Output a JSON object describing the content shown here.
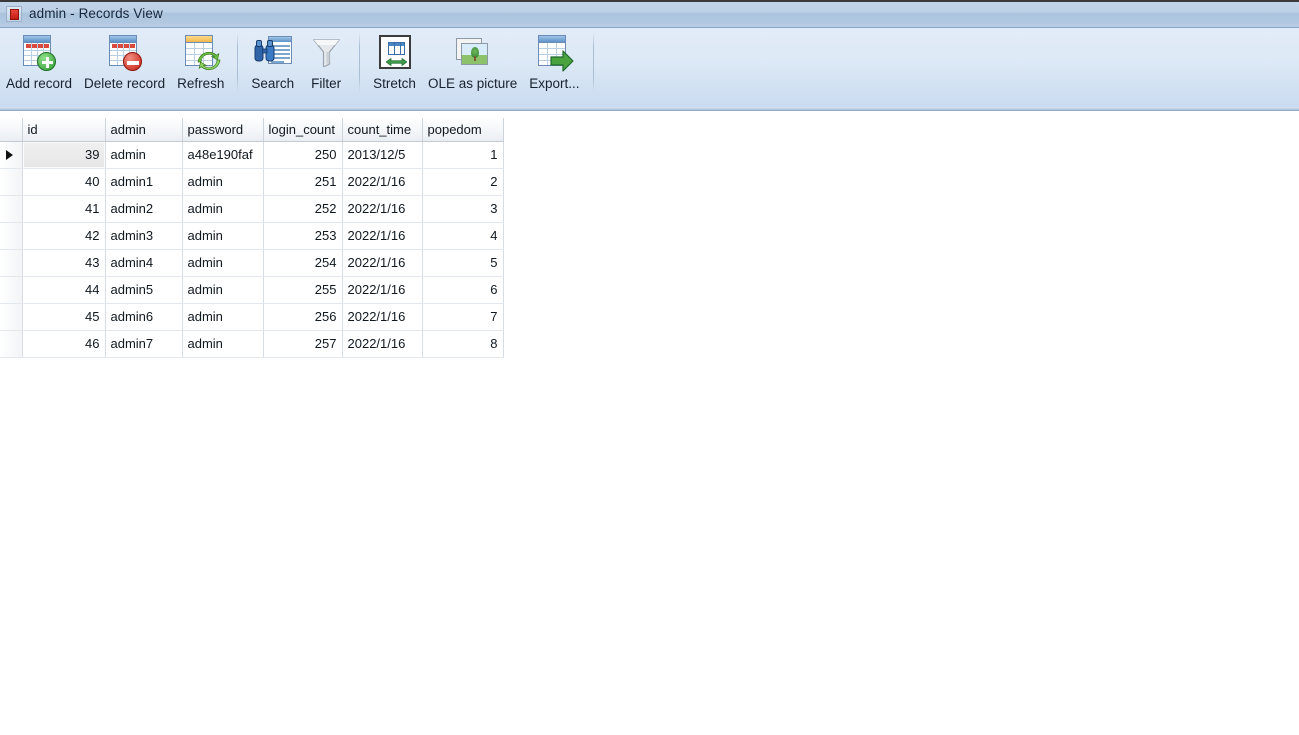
{
  "window": {
    "title": "admin - Records View",
    "icon": "database-record-icon",
    "icon_glyph": "Z"
  },
  "toolbar": {
    "buttons": [
      {
        "label": "Add record",
        "icon": "add-record-icon",
        "pressed": false
      },
      {
        "label": "Delete record",
        "icon": "delete-record-icon",
        "pressed": false
      },
      {
        "label": "Refresh",
        "icon": "refresh-icon",
        "pressed": false
      },
      {
        "label": "Search",
        "icon": "search-icon",
        "pressed": false
      },
      {
        "label": "Filter",
        "icon": "filter-icon",
        "pressed": false
      },
      {
        "label": "Stretch",
        "icon": "stretch-icon",
        "pressed": true
      },
      {
        "label": "OLE as picture",
        "icon": "ole-as-picture-icon",
        "pressed": false
      },
      {
        "label": "Export...",
        "icon": "export-icon",
        "pressed": false
      }
    ]
  },
  "grid": {
    "columns": [
      "id",
      "admin",
      "password",
      "login_count",
      "count_time",
      "popedom"
    ],
    "selected_row_index": 0,
    "focused_cell": {
      "row": 0,
      "column": "id"
    },
    "rows": [
      {
        "id": "39",
        "admin": "admin",
        "password": "a48e190faf",
        "login_count": "250",
        "count_time": "2013/12/5",
        "popedom": "1"
      },
      {
        "id": "40",
        "admin": "admin1",
        "password": "admin",
        "login_count": "251",
        "count_time": "2022/1/16",
        "popedom": "2"
      },
      {
        "id": "41",
        "admin": "admin2",
        "password": "admin",
        "login_count": "252",
        "count_time": "2022/1/16",
        "popedom": "3"
      },
      {
        "id": "42",
        "admin": "admin3",
        "password": "admin",
        "login_count": "253",
        "count_time": "2022/1/16",
        "popedom": "4"
      },
      {
        "id": "43",
        "admin": "admin4",
        "password": "admin",
        "login_count": "254",
        "count_time": "2022/1/16",
        "popedom": "5"
      },
      {
        "id": "44",
        "admin": "admin5",
        "password": "admin",
        "login_count": "255",
        "count_time": "2022/1/16",
        "popedom": "6"
      },
      {
        "id": "45",
        "admin": "admin6",
        "password": "admin",
        "login_count": "256",
        "count_time": "2022/1/16",
        "popedom": "7"
      },
      {
        "id": "46",
        "admin": "admin7",
        "password": "admin",
        "login_count": "257",
        "count_time": "2022/1/16",
        "popedom": "8"
      }
    ]
  },
  "colors": {
    "titlebar": "#b8cde4",
    "toolbar": "#dce7f5",
    "accent_blue": "#4a86c4",
    "add_badge": "#2f9a33",
    "delete_badge": "#c61f13",
    "grid_line": "#d6dde5",
    "text": "#101820"
  }
}
